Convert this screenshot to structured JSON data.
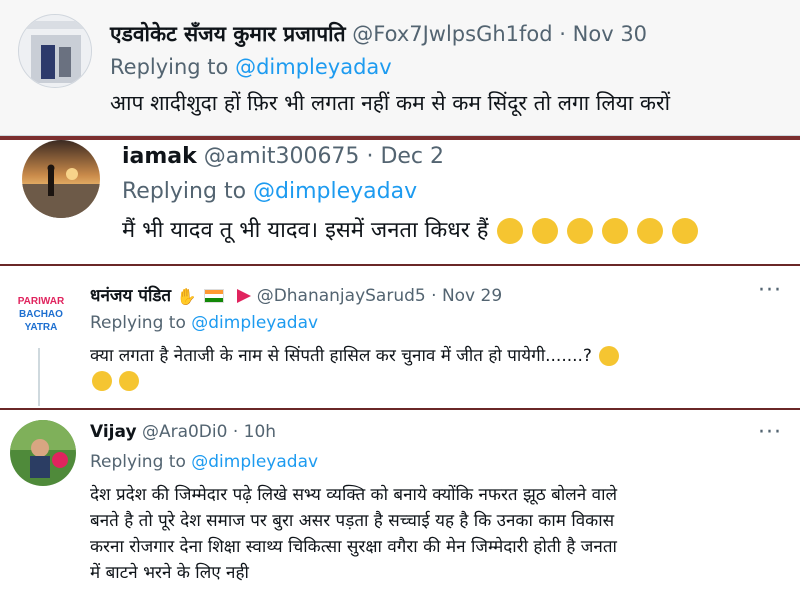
{
  "tweets": [
    {
      "name": "एडवोकेट सँजय कुमार प्रजापति",
      "handle": "@Fox7JwlpsGh1fod",
      "separator": "·",
      "date": "Nov 30",
      "replying_prefix": "Replying to",
      "replying_to": "@dimpleyadav",
      "text": "आप शादीशुदा हों फ़िर भी लगता नहीं कम से कम सिंदूर तो लगा लिया करों"
    },
    {
      "name": "iamak",
      "handle": "@amit300675",
      "separator": "·",
      "date": "Dec 2",
      "replying_prefix": "Replying to",
      "replying_to": "@dimpleyadav",
      "text": "मैं भी यादव तू भी यादव। इसमें जनता किधर हैं",
      "emoji": [
        "laugh-cry-emoji",
        "laugh-cry-emoji",
        "laugh-cry-emoji",
        "laugh-cry-emoji",
        "laugh-cry-emoji",
        "laugh-cry-emoji"
      ]
    },
    {
      "name": "धनंजय पंडित",
      "handle": "@DhananjaySarud5",
      "separator": "·",
      "date": "Nov 29",
      "replying_prefix": "Replying to",
      "replying_to": "@dimpleyadav",
      "text": "क्या लगता है नेताजी के नाम से सिंपती हासिल कर चुनाव में जीत हो पायेगी.......?",
      "avatar_lines": [
        "PARIWAR",
        "BACHAO",
        "YATRA"
      ],
      "more": "···"
    },
    {
      "name": "Vijay",
      "handle": "@Ara0Di0",
      "separator": "·",
      "date": "10h",
      "replying_prefix": "Replying to",
      "replying_to": "@dimpleyadav",
      "text_lines": [
        "देश प्रदेश की जिम्मेदार पढ़े लिखे सभ्य व्यक्ति को बनाये क्योंकि नफरत झूठ बोलने वाले",
        "बनते है तो पूरे देश समाज पर बुरा असर पड़ता है सच्चाई यह है कि उनका काम विकास",
        "करना रोजगार देना शिक्षा स्वाथ्य चिकित्सा सुरक्षा वगैरा की मेन जिम्मेदारी होती है जनता",
        "में बाटने भरने के लिए नही"
      ],
      "more": "···"
    }
  ],
  "colors": {
    "link": "#1d9bf0",
    "meta": "#536471",
    "separator_bar": "#7c2f2f"
  }
}
